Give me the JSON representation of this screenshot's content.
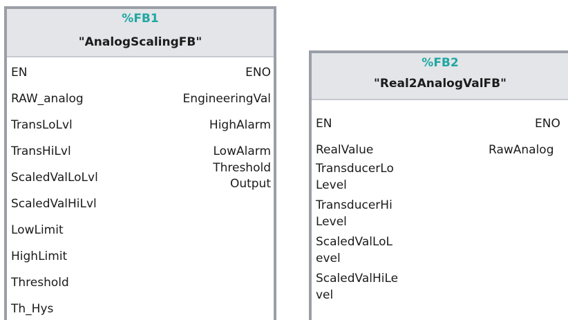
{
  "fb1": {
    "number": "%FB1",
    "name": "\"AnalogScalingFB\"",
    "inputs": [
      "EN",
      "RAW_analog",
      "TransLoLvl",
      "TransHiLvl",
      "ScaledValLoLvl",
      "ScaledValHiLvl",
      "LowLimit",
      "HighLimit",
      "Threshold",
      "Th_Hys"
    ],
    "outputs": [
      "ENO",
      "EngineeringVal",
      "HighAlarm",
      "LowAlarm",
      "Threshold",
      "Output"
    ]
  },
  "fb2": {
    "number": "%FB2",
    "name": "\"Real2AnalogValFB\"",
    "inputs": [
      "EN",
      "RealValue",
      "TransducerLoLevel",
      "TransducerHiLevel",
      "ScaledValLoLevel",
      "ScaledValHiLevel"
    ],
    "outputs": [
      "ENO",
      "RawAnalog"
    ]
  },
  "colors": {
    "block_border": "#9a9ea6",
    "header_bg": "#e3e5e9",
    "fb_number": "#1fa7a0"
  }
}
